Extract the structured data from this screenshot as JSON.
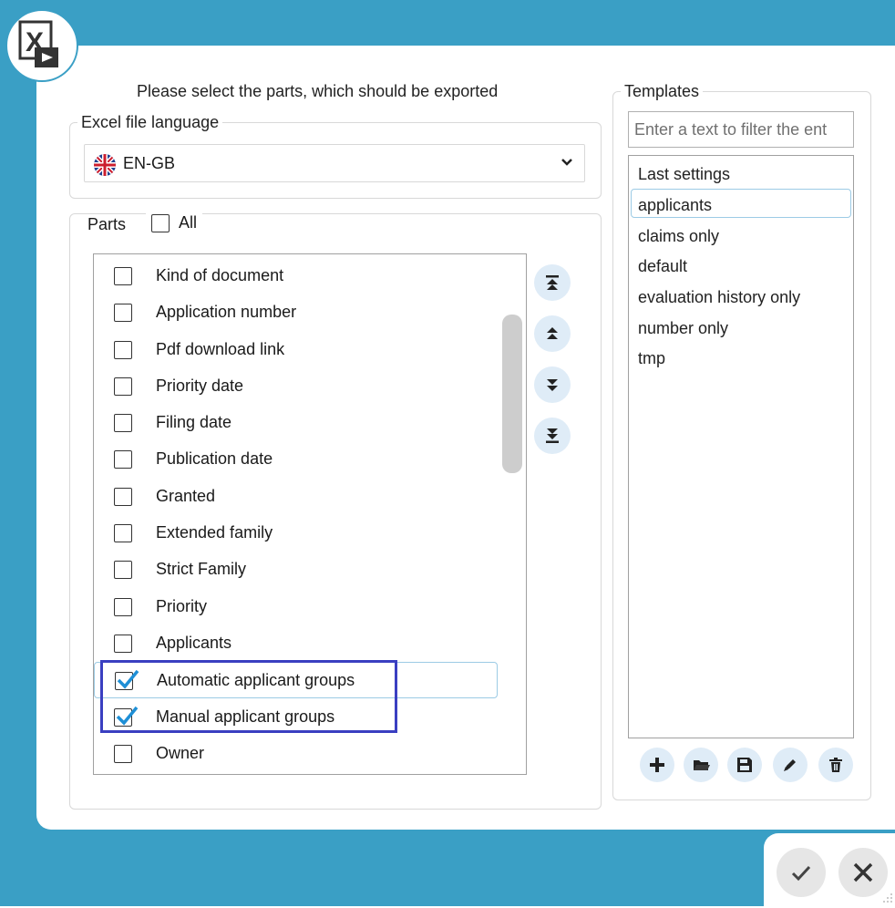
{
  "instruction": "Please select the parts, which should be exported",
  "language": {
    "legend": "Excel file language",
    "selected": "EN-GB",
    "flag_icon": "uk-flag-icon"
  },
  "parts": {
    "legend": "Parts",
    "all_label": "All",
    "all_checked": false,
    "items": [
      {
        "label": "Kind of document",
        "checked": false
      },
      {
        "label": "Application number",
        "checked": false
      },
      {
        "label": "Pdf download link",
        "checked": false
      },
      {
        "label": "Priority date",
        "checked": false
      },
      {
        "label": "Filing date",
        "checked": false
      },
      {
        "label": "Publication date",
        "checked": false
      },
      {
        "label": "Granted",
        "checked": false
      },
      {
        "label": "Extended family",
        "checked": false
      },
      {
        "label": "Strict Family",
        "checked": false
      },
      {
        "label": "Priority",
        "checked": false
      },
      {
        "label": "Applicants",
        "checked": false
      },
      {
        "label": "Automatic applicant groups",
        "checked": true
      },
      {
        "label": "Manual applicant groups",
        "checked": true
      },
      {
        "label": "Owner",
        "checked": false
      }
    ],
    "move_buttons": [
      "move-to-top-icon",
      "move-up-icon",
      "move-down-icon",
      "move-to-bottom-icon"
    ]
  },
  "templates": {
    "legend": "Templates",
    "filter_placeholder": "Enter a text to filter the ent",
    "items": [
      "Last settings",
      "applicants",
      "claims only",
      "default",
      "evaluation history only",
      "number only",
      "tmp"
    ],
    "selected": "applicants",
    "actions": [
      "add-icon",
      "open-folder-icon",
      "save-icon",
      "edit-icon",
      "delete-icon"
    ]
  },
  "footer": {
    "ok_icon": "checkmark-icon",
    "cancel_icon": "close-icon"
  },
  "colors": {
    "accent": "#3a9fc5",
    "highlight": "#3a3fc1",
    "check": "#1e8fd6"
  }
}
